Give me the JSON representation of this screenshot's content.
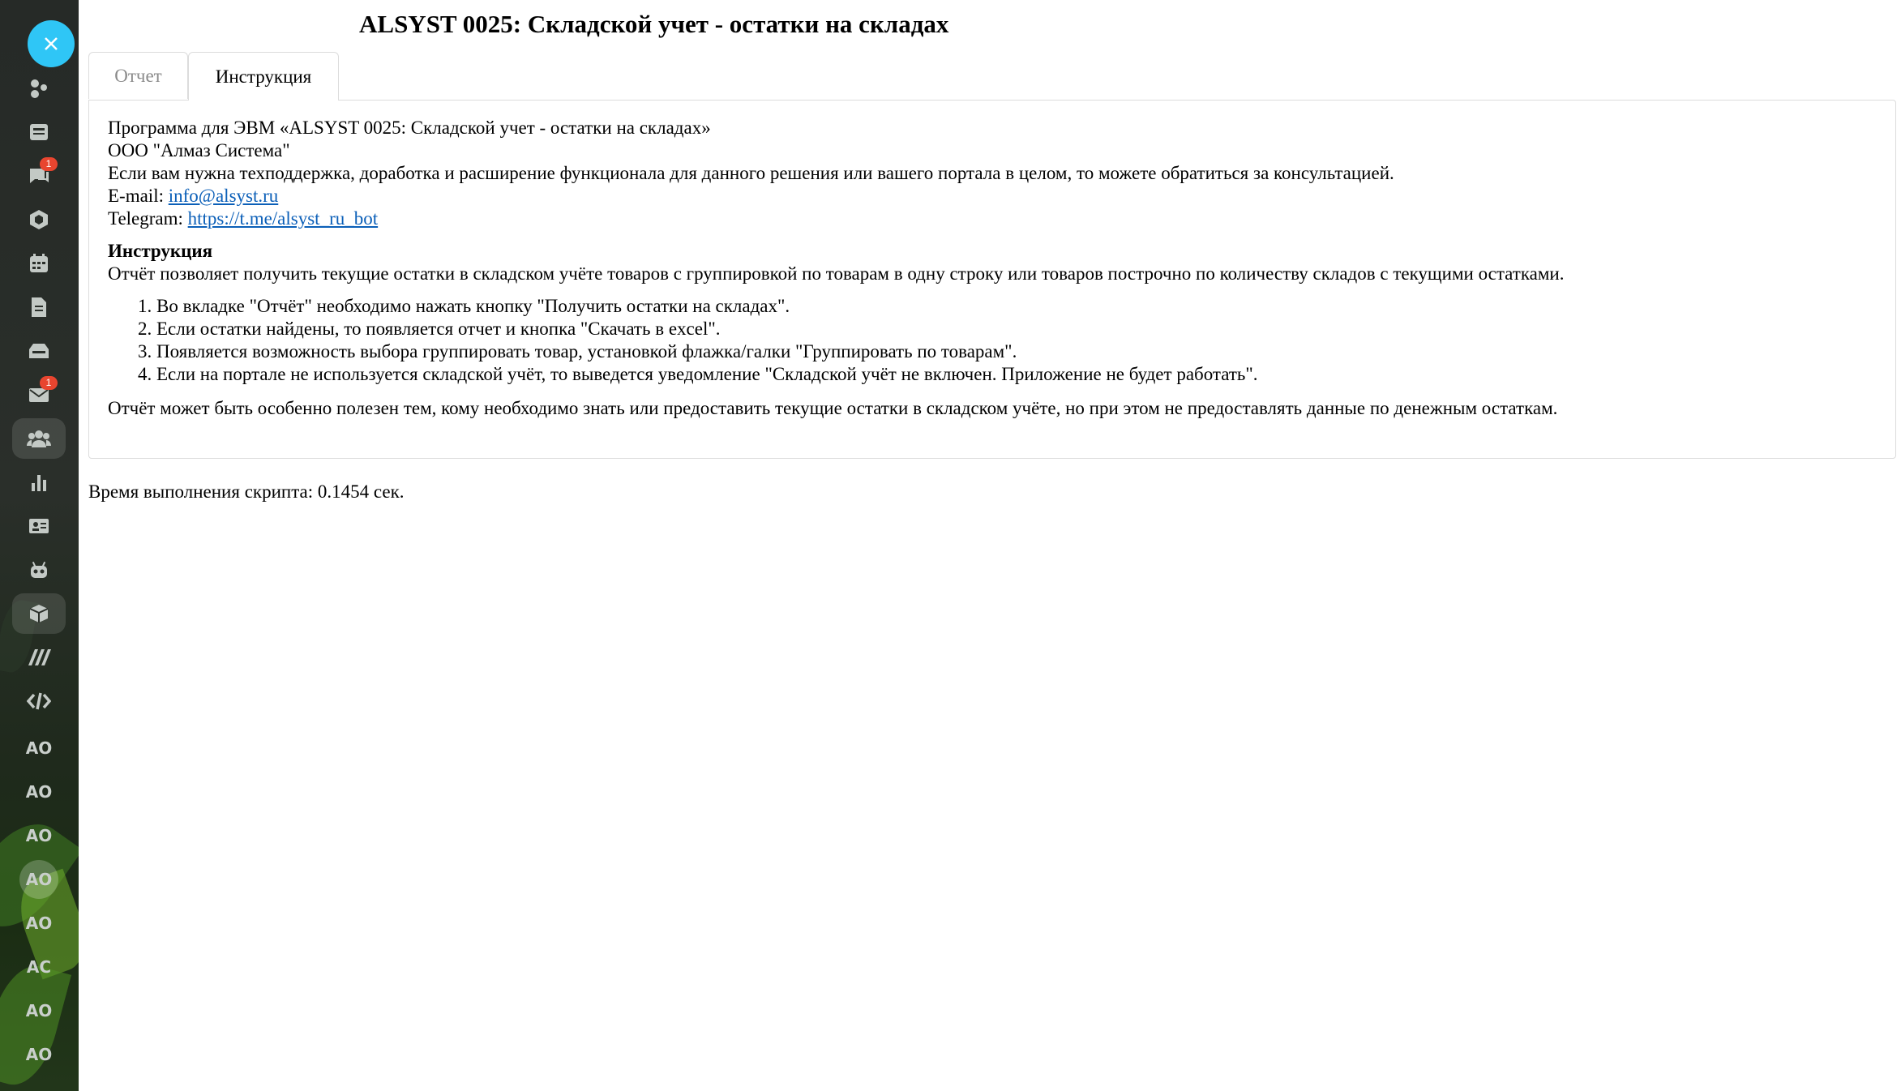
{
  "page": {
    "title": "ALSYST 0025: Складской учет - остатки на складах",
    "tabs": [
      {
        "label": "Отчет",
        "active": false
      },
      {
        "label": "Инструкция",
        "active": true
      }
    ]
  },
  "sidebar": {
    "close_icon": "close-icon",
    "items": [
      {
        "icon": "share-nodes-icon"
      },
      {
        "icon": "newspaper-icon"
      },
      {
        "icon": "chat-icon",
        "badge": "1"
      },
      {
        "icon": "hexagon-icon"
      },
      {
        "icon": "calendar-icon"
      },
      {
        "icon": "document-icon"
      },
      {
        "icon": "inbox-tray-icon"
      },
      {
        "icon": "mail-icon",
        "badge": "1"
      },
      {
        "icon": "users-icon"
      },
      {
        "icon": "bar-chart-icon"
      },
      {
        "icon": "contact-card-icon"
      },
      {
        "icon": "robot-icon"
      },
      {
        "icon": "cube-icon"
      },
      {
        "icon": "marketplace-icon"
      },
      {
        "icon": "code-icon"
      }
    ],
    "app_items": [
      "AO",
      "AO",
      "AO",
      "AO",
      "AO",
      "AC",
      "AO",
      "AO"
    ]
  },
  "instruction": {
    "program_line": "Программа для ЭВМ «ALSYST 0025: Складской учет - остатки на складах»",
    "company": "ООО \"Алмаз Система\"",
    "support_line": "Если вам нужна техподдержка, доработка и расширение функционала для данного решения или вашего портала в целом, то можете обратиться за консультацией.",
    "email_label": "E-mail:",
    "email": "info@alsyst.ru",
    "telegram_label": "Telegram:",
    "telegram": "https://t.me/alsyst_ru_bot",
    "heading": "Инструкция",
    "intro": "Отчёт позволяет получить текущие остатки в складском учёте товаров с группировкой по товарам в одну строку или товаров построчно по количеству складов с текущими остатками.",
    "steps": [
      "Во вкладке \"Отчёт\" необходимо нажать кнопку \"Получить остатки на складах\".",
      "Если остатки найдены, то появляется отчет и кнопка \"Скачать в excel\".",
      "Появляется возможность выбора группировать товар, установкой флажка/галки \"Группировать по товарам\".",
      "Если на портале не используется складской учёт, то выведется уведомление \"Складской учёт не включен. Приложение не будет работать\"."
    ],
    "outro": "Отчёт может быть особенно полезен тем, кому необходимо знать или предоставить текущие остатки в складском учёте, но при этом не предоставлять данные по денежным остаткам."
  },
  "footer": {
    "exec_time": "Время выполнения скрипта: 0.1454 сек."
  }
}
